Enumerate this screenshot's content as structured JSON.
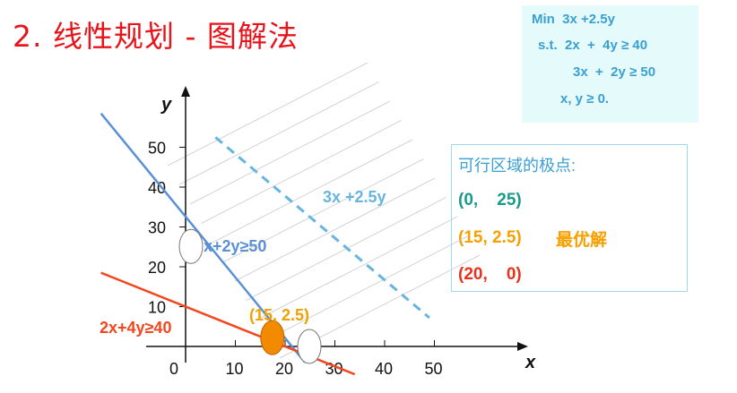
{
  "title": "2. 线性规划 - 图解法",
  "model": {
    "line1": "Min  3x +2.5y",
    "line2": "s.t.  2x  +  4y ≥ 40",
    "line3": "3x  +  2y ≥ 50",
    "line4": "x, y ≥ 0."
  },
  "extreme_points": {
    "heading": "可行区域的极点:",
    "p1": "(0,    25)",
    "p2": "(15, 2.5)",
    "p2_note": "最优解",
    "p3": "(20,    0)",
    "color_p1": "#1a9a8a",
    "color_p2": "#f5a000",
    "color_p3": "#e8321c"
  },
  "chart_data": {
    "type": "line",
    "xlabel": "x",
    "ylabel": "y",
    "xlim": [
      0,
      50
    ],
    "ylim": [
      0,
      50
    ],
    "x_ticks": [
      "0",
      "10",
      "20",
      "30",
      "40",
      "50"
    ],
    "y_ticks": [
      "10",
      "20",
      "30",
      "40",
      "50"
    ],
    "series": [
      {
        "name": "x+2y≥50",
        "color": "#5b8fd6",
        "points": [
          [
            -17,
            58.5
          ],
          [
            24,
            -4
          ]
        ]
      },
      {
        "name": "2x+4y≥40",
        "color": "#f2461e",
        "points": [
          [
            -17,
            18.5
          ],
          [
            34,
            -7
          ]
        ]
      },
      {
        "name": "3x +2.5y",
        "color": "#66b4e0",
        "style": "dashed",
        "points": [
          [
            6,
            52.5
          ],
          [
            49,
            7.2
          ]
        ]
      }
    ],
    "points": [
      {
        "label": "(15, 2.5)",
        "x": 16,
        "y": 2,
        "color": "#f28a00"
      }
    ],
    "marked_extremes": [
      [
        0,
        26
      ],
      [
        20,
        0
      ]
    ],
    "series_label_colors": {
      "line1": "#5b8fd6",
      "line2": "#f2461e",
      "objective": "#66b4e0",
      "point": "#f0a000"
    }
  }
}
